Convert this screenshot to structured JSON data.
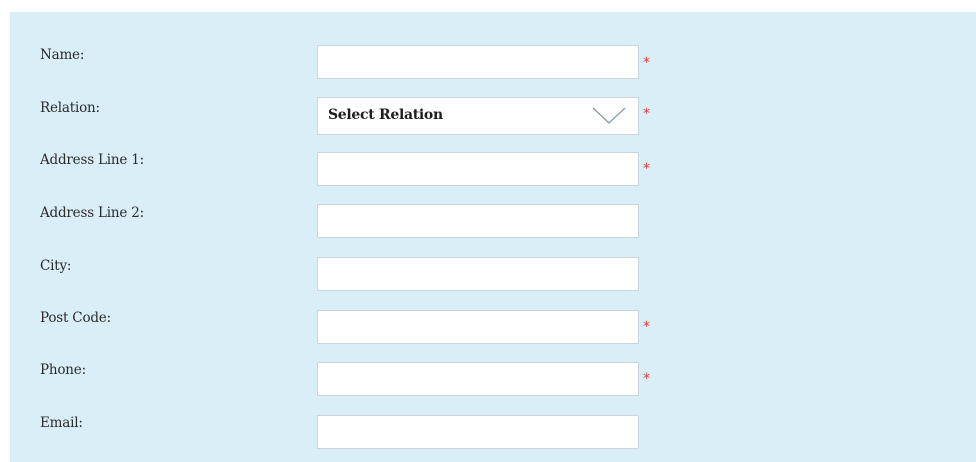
{
  "form": {
    "required_marker": "*",
    "fields": [
      {
        "label": "Name:",
        "value": "",
        "required": true
      },
      {
        "label": "Relation:",
        "selected": "Select Relation",
        "required": true
      },
      {
        "label": "Address Line 1:",
        "value": "",
        "required": true
      },
      {
        "label": "Address Line 2:",
        "value": "",
        "required": false
      },
      {
        "label": "City:",
        "value": "",
        "required": false
      },
      {
        "label": "Post Code:",
        "value": "",
        "required": true
      },
      {
        "label": "Phone:",
        "value": "",
        "required": true
      },
      {
        "label": "Email:",
        "value": "",
        "required": false
      }
    ]
  },
  "icons": {
    "relation_dropdown": "chevron-down-icon"
  },
  "colors": {
    "panel_background": "#daeef8",
    "required": "#e53935",
    "field_border": "#c9d6de"
  }
}
